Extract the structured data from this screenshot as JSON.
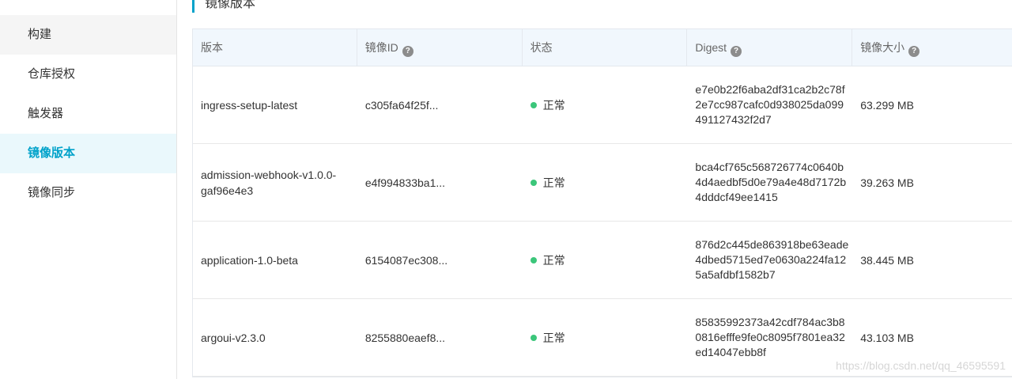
{
  "sidebar": {
    "top_partial_label": "…",
    "items": [
      {
        "label": "构建",
        "active": false
      },
      {
        "label": "仓库授权",
        "active": false
      },
      {
        "label": "触发器",
        "active": false
      },
      {
        "label": "镜像版本",
        "active": true
      },
      {
        "label": "镜像同步",
        "active": false
      }
    ]
  },
  "main": {
    "section_title": "镜像版本",
    "table": {
      "headers": {
        "version": "版本",
        "image_id": "镜像ID",
        "status": "状态",
        "digest": "Digest",
        "size": "镜像大小"
      },
      "rows": [
        {
          "version": "ingress-setup-latest",
          "image_id": "c305fa64f25f...",
          "status": "正常",
          "digest": "e7e0b22f6aba2df31ca2b2c78f2e7cc987cafc0d938025da099491127432f2d7",
          "size": "63.299 MB"
        },
        {
          "version": "admission-webhook-v1.0.0-gaf96e4e3",
          "image_id": "e4f994833ba1...",
          "status": "正常",
          "digest": "bca4cf765c568726774c0640b4d4aedbf5d0e79a4e48d7172b4dddcf49ee1415",
          "size": "39.263 MB"
        },
        {
          "version": "application-1.0-beta",
          "image_id": "6154087ec308...",
          "status": "正常",
          "digest": "876d2c445de863918be63eade4dbed5715ed7e0630a224fa125a5afdbf1582b7",
          "size": "38.445 MB"
        },
        {
          "version": "argoui-v2.3.0",
          "image_id": "8255880eaef8...",
          "status": "正常",
          "digest": "85835992373a42cdf784ac3b80816efffe9fe0c8095f7801ea32ed14047ebb8f",
          "size": "43.103 MB"
        }
      ]
    }
  },
  "watermark": "https://blog.csdn.net/qq_46595591",
  "colors": {
    "accent": "#00a2ca",
    "status_ok": "#3bc67a",
    "header_bg": "#f1f7fd",
    "sidebar_active_bg": "#eaf8fc"
  }
}
